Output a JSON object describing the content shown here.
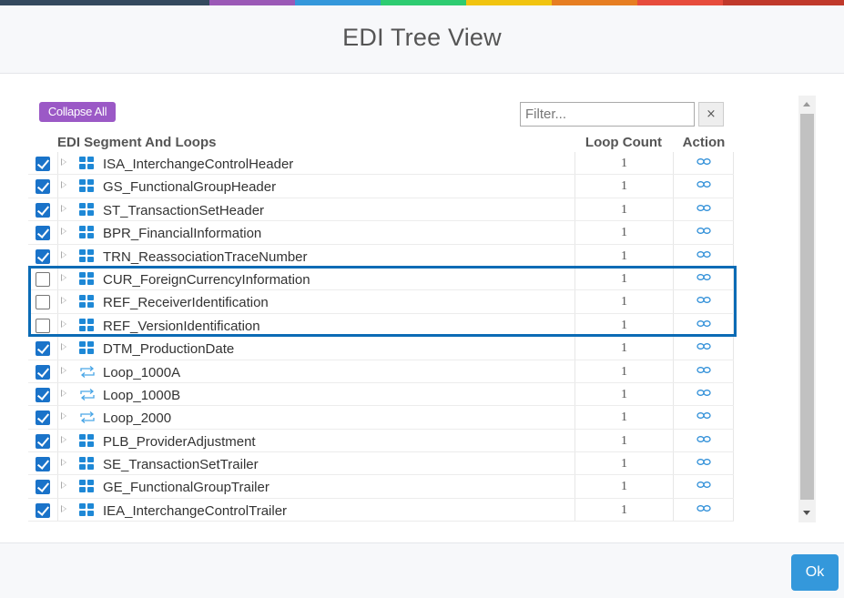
{
  "color_bar": [
    "#34495e",
    "#9b59b6",
    "#3498db",
    "#2ecc71",
    "#f1c40f",
    "#e67e22",
    "#e74c3c",
    "#c0392b"
  ],
  "dialog": {
    "title": "EDI Tree View",
    "ok_label": "Ok"
  },
  "toolbar": {
    "collapse_all_label": "Collapse All",
    "filter_placeholder": "Filter...",
    "filter_value": "",
    "clear_label": "×"
  },
  "columns": {
    "segment": "EDI Segment And Loops",
    "loop_count": "Loop Count",
    "action": "Action"
  },
  "rows": [
    {
      "name": "ISA_InterchangeControlHeader",
      "checked": true,
      "type": "segment-icon",
      "loop_count": "1"
    },
    {
      "name": "GS_FunctionalGroupHeader",
      "checked": true,
      "type": "segment-icon",
      "loop_count": "1"
    },
    {
      "name": "ST_TransactionSetHeader",
      "checked": true,
      "type": "segment-icon",
      "loop_count": "1"
    },
    {
      "name": "BPR_FinancialInformation",
      "checked": true,
      "type": "segment-icon",
      "loop_count": "1"
    },
    {
      "name": "TRN_ReassociationTraceNumber",
      "checked": true,
      "type": "segment-icon",
      "loop_count": "1"
    },
    {
      "name": "CUR_ForeignCurrencyInformation",
      "checked": false,
      "type": "segment-icon",
      "loop_count": "1"
    },
    {
      "name": "REF_ReceiverIdentification",
      "checked": false,
      "type": "segment-icon",
      "loop_count": "1"
    },
    {
      "name": "REF_VersionIdentification",
      "checked": false,
      "type": "segment-icon",
      "loop_count": "1"
    },
    {
      "name": "DTM_ProductionDate",
      "checked": true,
      "type": "segment-icon",
      "loop_count": "1"
    },
    {
      "name": "Loop_1000A",
      "checked": true,
      "type": "loop-icon",
      "loop_count": "1"
    },
    {
      "name": "Loop_1000B",
      "checked": true,
      "type": "loop-icon",
      "loop_count": "1"
    },
    {
      "name": "Loop_2000",
      "checked": true,
      "type": "loop-icon",
      "loop_count": "1"
    },
    {
      "name": "PLB_ProviderAdjustment",
      "checked": true,
      "type": "segment-icon",
      "loop_count": "1"
    },
    {
      "name": "SE_TransactionSetTrailer",
      "checked": true,
      "type": "segment-icon",
      "loop_count": "1"
    },
    {
      "name": "GE_FunctionalGroupTrailer",
      "checked": true,
      "type": "segment-icon",
      "loop_count": "1"
    },
    {
      "name": "IEA_InterchangeControlTrailer",
      "checked": true,
      "type": "segment-icon",
      "loop_count": "1"
    }
  ],
  "colors": {
    "accent_blue": "#1a73c9",
    "collapse_purple": "#9b59c6",
    "highlight_border": "#0b6bb5",
    "ok_blue": "#3498db",
    "icon_blue": "#1e88d6"
  }
}
